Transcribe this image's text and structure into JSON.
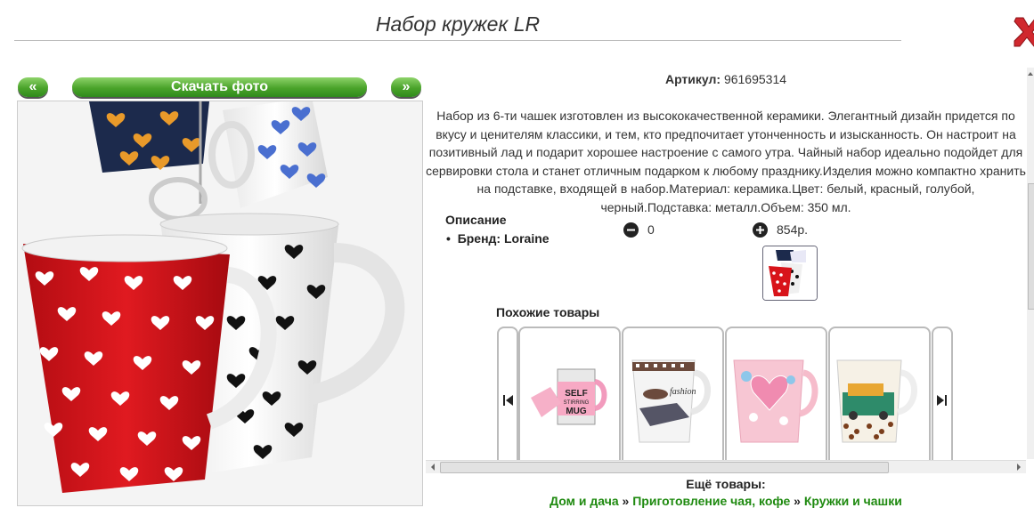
{
  "title": "Набор кружек LR",
  "nav": {
    "prev_label": "«",
    "download_label": "Скачать фото",
    "next_label": "»"
  },
  "article": {
    "label": "Артикул:",
    "value": "961695314"
  },
  "description": "Набор из 6-ти чашек изготовлен из высококачественной керамики. Элегантный дизайн придется по вкусу и ценителям классики, и тем, кто предпочитает утонченность и изысканность. Он настроит на позитивный лад и подарит хорошее настроение с самого утра. Чайный набор идеально подойдет для сервировки стола и станет отличным подарком к любому празднику.Изделия можно компактно хранить на подставке, входящей в набор.Материал: керамика.Цвет: белый, красный, голубой, черный.Подставка: металл.Объем: 350 мл.",
  "specs": {
    "heading": "Описание",
    "brand": "Бренд: Loraine"
  },
  "cart": {
    "quantity": "0",
    "price": "854р."
  },
  "similar": {
    "heading": "Похожие товары",
    "mug_text": [
      "SELF",
      "STIRRING",
      "MUG"
    ],
    "fashion_text": "fashion"
  },
  "more": {
    "heading": "Ещё товары:",
    "crumbs": [
      "Дом и дача",
      "Приготовление чая, кофе",
      "Кружки и чашки"
    ],
    "separator": "»"
  },
  "colors": {
    "accent_green": "#4aa32a",
    "mug_red": "#d8141a",
    "link_green": "#1f8a10",
    "close_red": "#d0282e"
  }
}
